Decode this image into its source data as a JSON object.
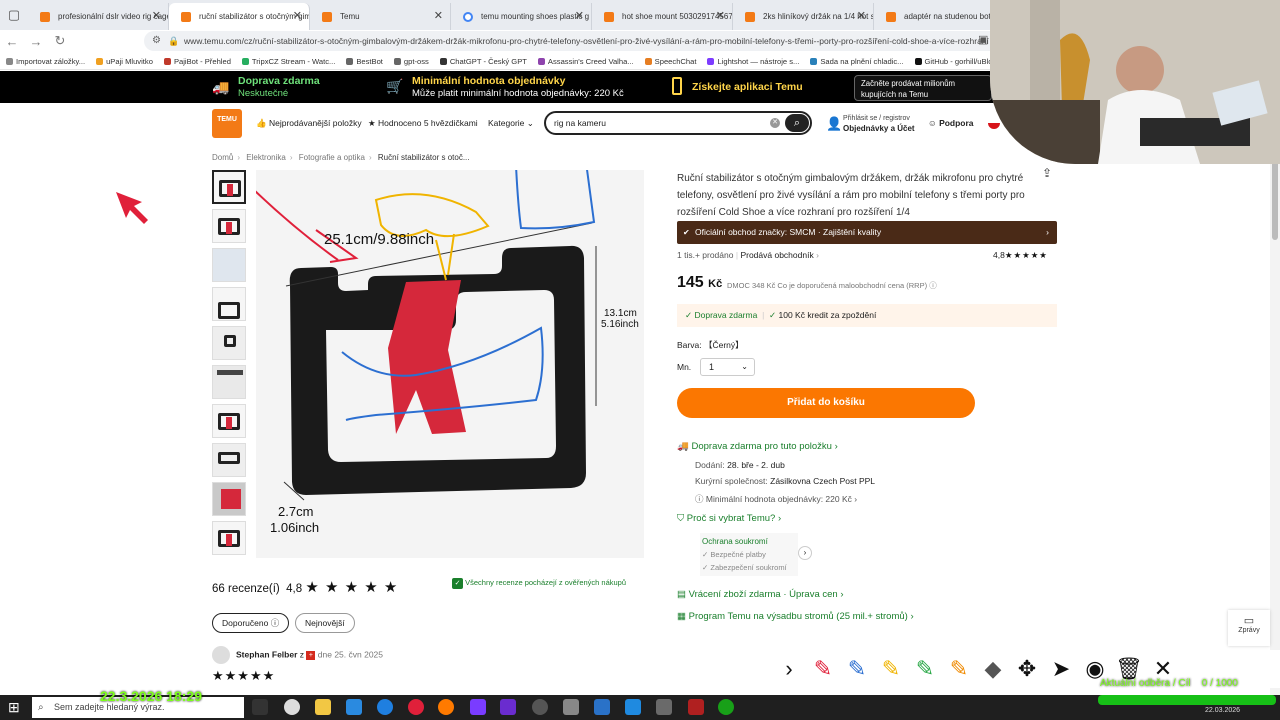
{
  "browser": {
    "tabs": [
      {
        "label": "profesionální dslr video rig cage",
        "active": false,
        "fav": "temu"
      },
      {
        "label": "ruční stabilizátor s otočným gim",
        "active": true,
        "fav": "temu"
      },
      {
        "label": "Temu",
        "active": false,
        "fav": "temu"
      },
      {
        "label": "temu mounting shoes plastic g",
        "active": false,
        "fav": "google"
      },
      {
        "label": "hot shoe mount 503029174567",
        "active": false,
        "fav": "temu"
      },
      {
        "label": "2ks hliníkový držák na 1/4 hot s",
        "active": false,
        "fav": "temu"
      },
      {
        "label": "adaptér na studenou botu z hli",
        "active": false,
        "fav": "temu"
      }
    ],
    "url": "www.temu.com/cz/ruční-stabilizátor-s-otočným-gimbalovým-držákem-držák-mikrofonu-pro-chytré-telefony-osvětlení-pro-živé-vysílání-a-rám-pro-mobilní-telefony-s-třemi--porty-pro-rozšíření-cold-shoe-a-více-rozhraní",
    "bookmarks": [
      "Importovat záložky...",
      "uPaji Mluvitko",
      "PajiBot - Přehled",
      "TripxCZ Stream - Watc...",
      "BestBot",
      "gpt-oss",
      "ChatGPT - Český GPT",
      "Assassin's Creed Valha...",
      "SpeechChat",
      "Lightshot — nástroje s...",
      "Sada na plnění chladic...",
      "GitHub - gorhill/uBloc..."
    ]
  },
  "promo": {
    "ship_title": "Doprava zdarma",
    "ship_sub": "Neskutečné",
    "min_title": "Minimální hodnota objednávky",
    "min_sub": "Může platit minimální hodnota objednávky: 220 Kč",
    "app": "Získejte aplikaci Temu",
    "sell": "Začněte prodávat milionům kupujících na Temu"
  },
  "header": {
    "logo": "TEMU",
    "best": "Nejprodávanější položky",
    "rated": "Hodnoceno 5 hvězdičkami",
    "categories": "Kategorie",
    "search_value": "rig na kameru",
    "login": "Přihlásit se / registrov",
    "orders": "Objednávky a Účet",
    "support": "Podpora"
  },
  "breadcrumb": [
    "Domů",
    "Elektronika",
    "Fotografie a optika",
    "Ruční stabilizátor s otoč..."
  ],
  "product": {
    "title": "Ruční stabilizátor s otočným gimbalovým držákem, držák mikrofonu pro chytré telefony, osvětlení pro živé vysílání a rám pro mobilní telefony s třemi porty pro rozšíření Cold Shoe a více rozhraní pro rozšíření 1/4",
    "official": "Oficiální obchod značky: SMCM · Zajištění kvality",
    "sold": "1 tis.+ prodáno",
    "seller": "Prodává obchodník",
    "rating": "4,8",
    "price": "145",
    "currency": "Kč",
    "rrp": "DMOC 348 Kč Co je doporučená maloobchodní cena (RRP)",
    "free_ship": "Doprava zdarma",
    "credit": "100 Kč kredit za zpoždění",
    "color_label": "Barva:",
    "color_value": "【Černý】",
    "qty_label": "Mn.",
    "qty_value": "1",
    "add_to_cart": "Přidat do košíku",
    "ship_line": "Doprava zdarma pro tuto položku",
    "delivery_label": "Dodání:",
    "delivery_value": "28. bře - 2. dub",
    "couriers_label": "Kurýrní společnost:",
    "couriers": "Zásilkovna  Czech Post  PPL",
    "min_order": "Minimální hodnota objednávky: 220 Kč",
    "why": "Proč si vybrat Temu?",
    "privacy_title": "Ochrana soukromí",
    "privacy_1": "Bezpečné platby",
    "privacy_2": "Zabezpečení soukromí",
    "returns": "Vrácení zboží zdarma · Úprava cen",
    "trees": "Program Temu na výsadbu stromů (25 mil.+ stromů)"
  },
  "image_labels": {
    "width": "25.1cm/9.88inch",
    "height_cm": "13.1cm",
    "height_in": "5.16inch",
    "depth_cm": "2.7cm",
    "depth_in": "1.06inch"
  },
  "reviews": {
    "count": "66 recenze(í)",
    "score": "4,8",
    "verified": "Všechny recenze pocházejí z ověřených nákupů",
    "sort_recommended": "Doporučeno",
    "sort_newest": "Nejnovější",
    "reviewer": "Stephan Felber",
    "reviewer_country": "z",
    "review_date": "dne 25. čvn 2025"
  },
  "side": {
    "messages": "Zprávy"
  },
  "overlay": {
    "timestamp": "22.3.2026 18:29",
    "obs_label": "Aktuální odběra / Cíl",
    "obs_value": "0 / 1000"
  },
  "taskbar": {
    "search_placeholder": "Sem zadejte hledaný výraz.",
    "clock": "22.03.2026"
  },
  "colors": {
    "accent": "#fb7701",
    "green": "#1a7f2c",
    "official_bg": "#4a2a17",
    "annotation_red": "#e0203a",
    "annotation_blue": "#2c6fd1",
    "annotation_yellow": "#f0b400"
  }
}
